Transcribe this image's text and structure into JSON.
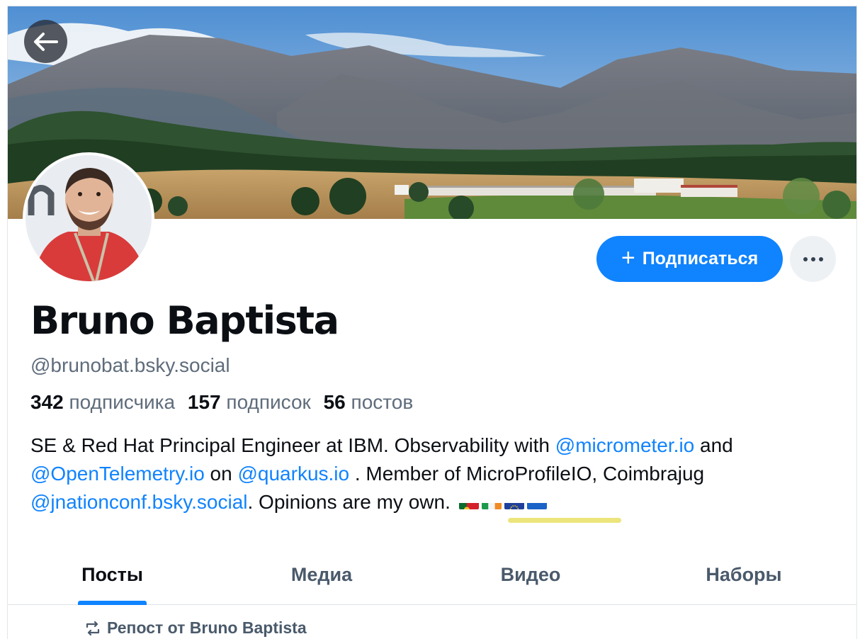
{
  "header": {
    "back_icon": "arrow-left-icon",
    "banner": "mountain-landscape-banner",
    "avatar": "profile-photo"
  },
  "actions": {
    "follow_label": "Подписаться",
    "follow_icon": "plus-icon",
    "more_icon": "ellipsis-icon"
  },
  "profile": {
    "display_name": "Bruno Baptista",
    "handle": "@brunobat.bsky.social",
    "stats": {
      "followers_count": "342",
      "followers_label": "подписчика",
      "following_count": "157",
      "following_label": "подписок",
      "posts_count": "56",
      "posts_label": "постов"
    },
    "bio": {
      "text1": "SE & Red Hat Principal Engineer at IBM.  Observability with ",
      "link1": "@micrometer.io",
      "text2": " and ",
      "link2": "@OpenTelemetry.io",
      "text3": " on ",
      "link3": "@quarkus.io",
      "text4": " . Member of MicroProfileIO, Coimbrajug ",
      "link4": "@jnationconf.bsky.social",
      "text5": ". Opinions are my own. ",
      "flags": [
        "flag-portugal",
        "flag-ireland",
        "flag-eu",
        "flag-ukraine"
      ]
    }
  },
  "tabs": [
    {
      "label": "Посты",
      "active": true
    },
    {
      "label": "Медиа",
      "active": false
    },
    {
      "label": "Видео",
      "active": false
    },
    {
      "label": "Наборы",
      "active": false
    }
  ],
  "feed": {
    "repost_label": "Репост от Bruno Baptista",
    "repost_icon": "repost-icon"
  },
  "colors": {
    "accent": "#1083fe",
    "muted_text": "#5f6c7b",
    "highlight": "#ece57c"
  }
}
